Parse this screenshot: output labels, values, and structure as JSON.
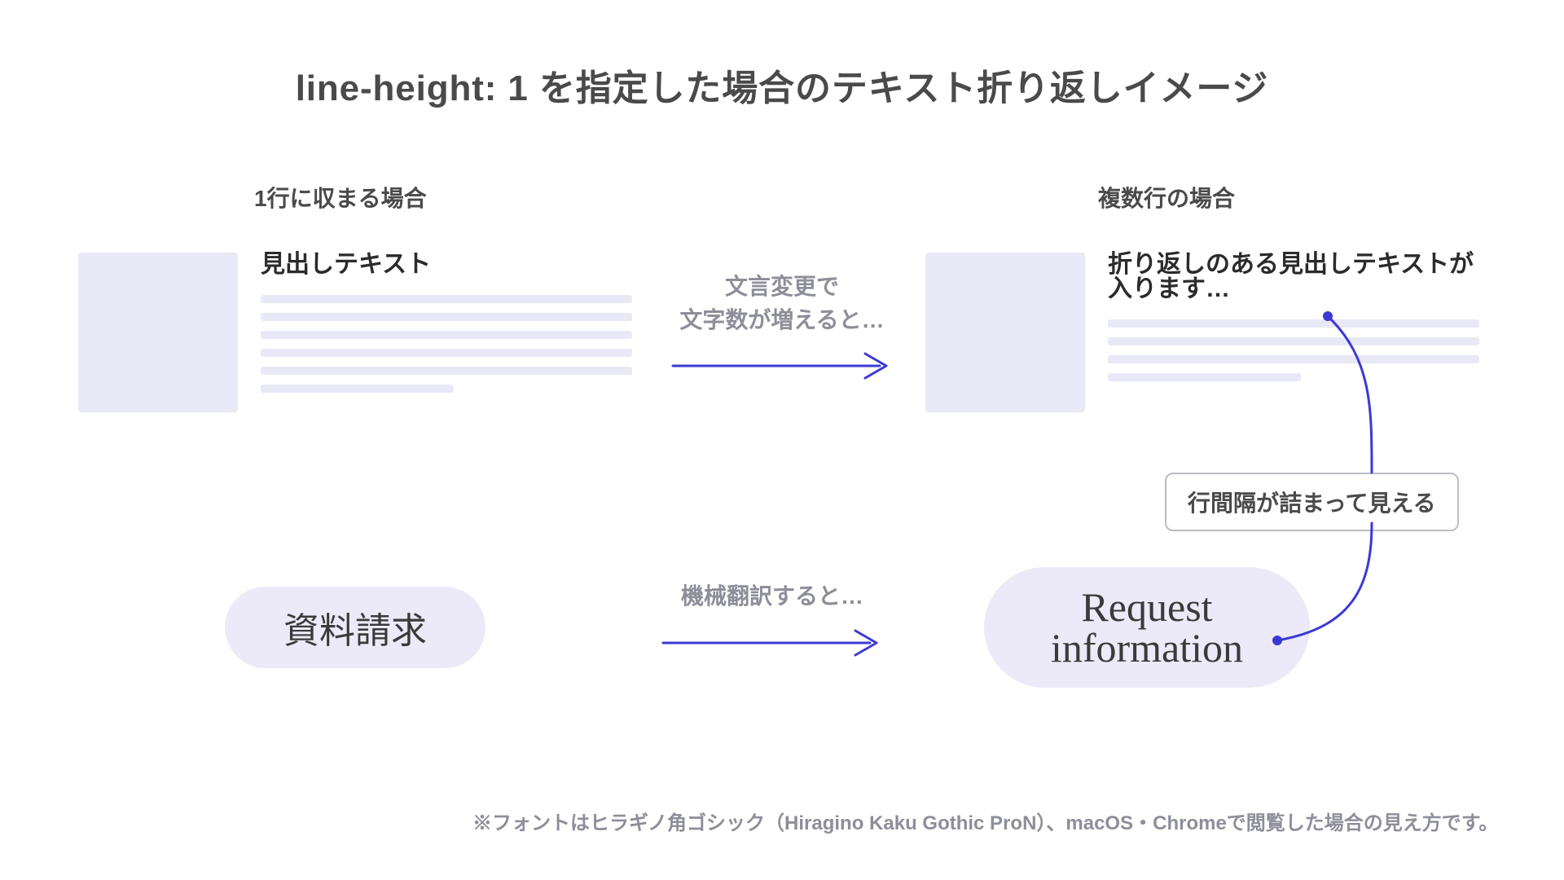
{
  "title": "line-height: 1 を指定した場合のテキスト折り返しイメージ",
  "cases": {
    "single": {
      "label": "1行に収まる場合",
      "heading": "見出しテキスト"
    },
    "multi": {
      "label": "複数行の場合",
      "heading": "折り返しのある見出しテキストが入ります…"
    }
  },
  "arrows": {
    "top": {
      "caption": "文言変更で\n文字数が増えると…"
    },
    "bottom": {
      "caption": "機械翻訳すると…"
    }
  },
  "annotation": "行間隔が詰まって見える",
  "pills": {
    "left": "資料請求",
    "right": "Request\ninformation"
  },
  "footnote": "※フォントはヒラギノ角ゴシック（Hiragino Kaku Gothic ProN）、macOS・Chromeで閲覧した場合の見え方です。",
  "colors": {
    "accent": "#3b39d6",
    "skeleton": "#e9e8f7",
    "muted_text": "#8e8e99"
  }
}
